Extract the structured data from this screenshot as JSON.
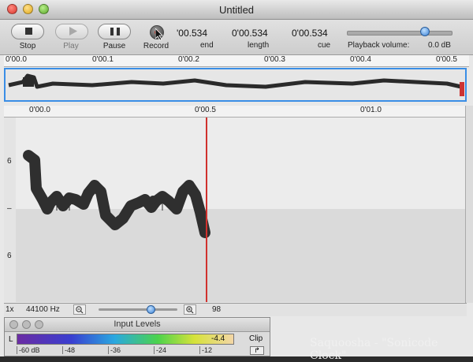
{
  "window": {
    "title": "Untitled"
  },
  "toolbar": {
    "stop_label": "Stop",
    "play_label": "Play",
    "pause_label": "Pause",
    "record_label": "Record",
    "start_time": "'00.534",
    "end_time": "0'00.534",
    "end_label": "end",
    "length_time": "0'00.534",
    "length_label": "length",
    "cue_time": "0'00.534",
    "cue_label": "cue",
    "volume_label": "Playback volume:",
    "volume_value": "0.0 dB",
    "volume_level": 0.72
  },
  "overview_ruler": {
    "ticks": [
      "0'00.0",
      "0'00.1",
      "0'00.2",
      "0'00.3",
      "0'00.4",
      "0'00.5"
    ]
  },
  "editor_ruler": {
    "ticks": [
      "0'00.0",
      "0'00.5",
      "0'01.0"
    ]
  },
  "vertical_scale": {
    "labels": [
      "6",
      "–",
      "6"
    ]
  },
  "statusbar": {
    "zoom_factor": "1x",
    "sample_rate": "44100 Hz",
    "zoom_out_icon": "zoom-out-icon",
    "zoom_in_icon": "zoom-in-icon",
    "zoom_value": "98"
  },
  "input_levels": {
    "title": "Input Levels",
    "channel": "L",
    "level_value": "-4.4",
    "clip_label": "Clip",
    "clip_reset_icon": "reset-arrow-icon",
    "scale": [
      "-60 dB",
      "-48",
      "-36",
      "-24",
      "-12"
    ]
  },
  "caption": "Saquoosha - \"Sonicode Clock\"",
  "colors": {
    "accent": "#3a8ee6",
    "playhead": "#d0312d",
    "waveform": "#2f2f2f"
  }
}
